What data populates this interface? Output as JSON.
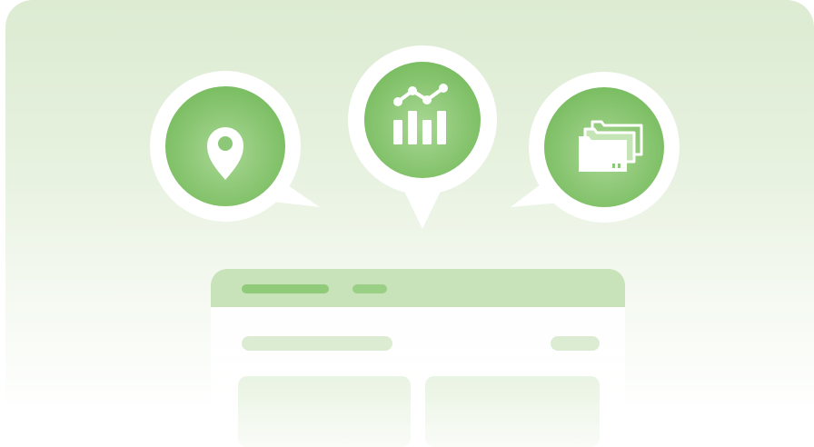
{
  "illustration": {
    "badges": [
      {
        "icon": "map-pin-icon"
      },
      {
        "icon": "bar-chart-icon"
      },
      {
        "icon": "folders-icon"
      }
    ],
    "colors": {
      "accent": "#7cbf63",
      "accent_light": "#b7dca5",
      "background_top": "#dcebd2",
      "background_bottom": "#ffffff"
    }
  }
}
